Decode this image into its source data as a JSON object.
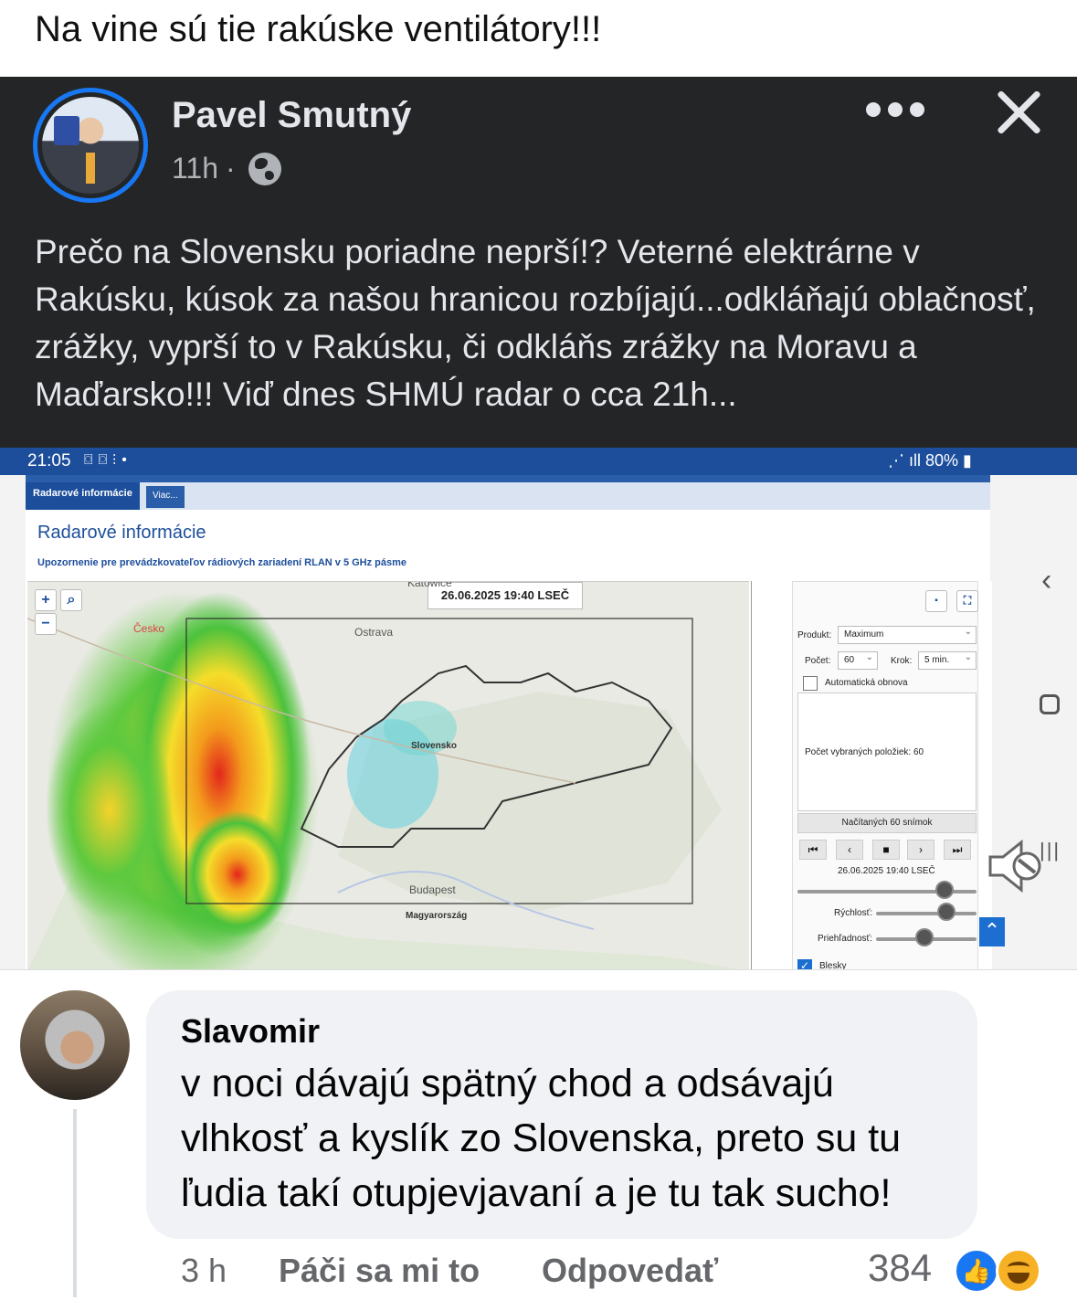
{
  "caption": "Na vine sú tie rakúske ventilátory!!!",
  "post": {
    "author": "Pavel Smutný",
    "time": "11h",
    "separator": "·",
    "text": "Prečo na Slovensku poriadne neprší!? Veterné elektrárne v Rakúsku, kúsok za našou hranicou rozbíjajú...odkláňajú oblačnosť, zrážky, vyprší to v Rakúsku, či odkláňs zrážky na Moravu a Maďarsko!!! Viď dnes SHMÚ radar o cca 21h...",
    "icons": [
      "globe-icon",
      "more-icon",
      "close-icon"
    ]
  },
  "screenshot": {
    "status_time": "21:05",
    "status_battery": "80%",
    "active_tab": "Radarové informácie",
    "more_tab": "Viac...",
    "page_title": "Radarové informácie",
    "notice": "Upozornenie pre prevádzkovateľov rádiových zariadení RLAN v 5 GHz pásme",
    "map": {
      "timestamp": "26.06.2025 19:40 LSEČ",
      "zoom_in": "+",
      "zoom_out": "−",
      "labels": {
        "ostrava": "Ostrava",
        "slovensko": "Slovensko",
        "budapest": "Budapest",
        "magyarorszag": "Magyarország",
        "katowice": "Katowice",
        "cesko": "Česko"
      }
    },
    "controls": {
      "product_label": "Produkt:",
      "product_value": "Maximum",
      "count_label": "Počet:",
      "count_value": "60",
      "step_label": "Krok:",
      "step_value": "5 min.",
      "auto_refresh": "Automatická obnova",
      "selected_items": "Počet vybraných položiek: 60",
      "loaded": "Načítaných 60 snímok",
      "frame_time": "26.06.2025 19:40 LSEČ",
      "speed_label": "Rýchlosť:",
      "opacity_label": "Priehľadnosť:",
      "lightning_label": "Blesky",
      "timeline_level": 0.82,
      "speed_level": 0.7,
      "opacity_level": 0.48
    }
  },
  "comment": {
    "author": "Slavomir",
    "text": "v noci dávajú spätný chod a odsávajú vlhkosť a kyslík zo Slovenska, preto su tu ľudia takí otupjevjavaní a je tu tak sucho!",
    "time": "3 h",
    "like_action": "Páči sa mi to",
    "reply_action": "Odpovedať",
    "reaction_count": "384",
    "reactions": [
      "like-icon",
      "haha-icon"
    ]
  },
  "colors": {
    "dark_post_bg": "#242526",
    "facebook_blue": "#1877f2",
    "shmu_blue": "#1c4e9b",
    "comment_bubble": "#f0f2f5"
  }
}
